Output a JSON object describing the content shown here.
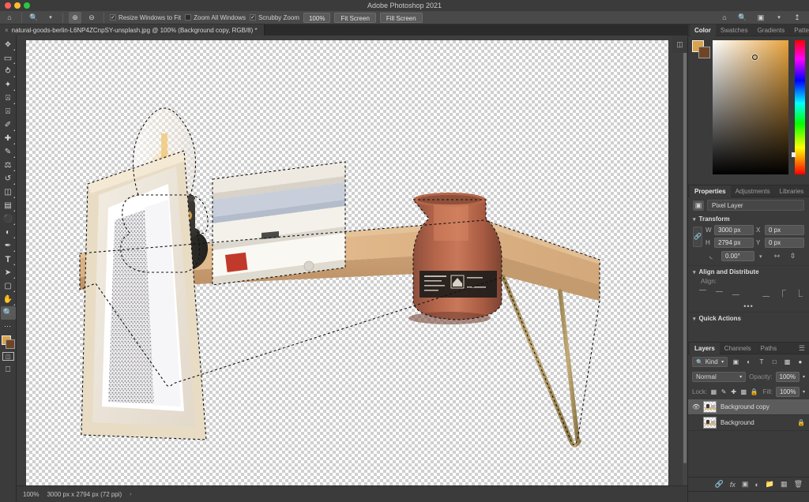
{
  "window": {
    "title": "Adobe Photoshop 2021"
  },
  "options_bar": {
    "home_icon": "home-icon",
    "tool_icon": "zoom-tool-icon",
    "preset_caret": "chevron-down-icon",
    "zoom_in_icon": "zoom-in-icon",
    "zoom_out_icon": "zoom-out-icon",
    "checkboxes": [
      {
        "label": "Resize Windows to Fit",
        "checked": true
      },
      {
        "label": "Zoom All Windows",
        "checked": false
      },
      {
        "label": "Scrubby Zoom",
        "checked": true
      }
    ],
    "zoom_value": "100%",
    "buttons": [
      "Fit Screen",
      "Fill Screen"
    ],
    "right_icons": [
      "discover-icon",
      "search-icon",
      "arrange-documents-icon",
      "chevron-down-icon",
      "share-icon"
    ]
  },
  "document_tab": {
    "title": "natural-goods-berlin-L6NP4ZCnpSY-unsplash.jpg @ 100% (Background copy, RGB/8) *",
    "close_glyph": "×"
  },
  "toolbar": {
    "tools": [
      {
        "name": "move-tool",
        "glyph": "✥",
        "active": false,
        "group": true
      },
      {
        "name": "rectangular-marquee-tool",
        "glyph": "▭",
        "active": false,
        "group": true
      },
      {
        "name": "lasso-tool",
        "glyph": "ᒐ",
        "active": false,
        "group": true
      },
      {
        "name": "object-selection-tool",
        "glyph": "✧",
        "active": false,
        "group": true
      },
      {
        "name": "crop-tool",
        "glyph": "⌗",
        "active": false,
        "group": true
      },
      {
        "name": "frame-tool",
        "glyph": "⧉",
        "active": false,
        "group": false
      },
      {
        "name": "eyedropper-tool",
        "glyph": "✐",
        "active": false,
        "group": true
      },
      {
        "name": "spot-healing-brush-tool",
        "glyph": "✚",
        "active": false,
        "group": true
      },
      {
        "name": "brush-tool",
        "glyph": "🖌",
        "active": false,
        "group": true
      },
      {
        "name": "clone-stamp-tool",
        "glyph": "⌁",
        "active": false,
        "group": true
      },
      {
        "name": "history-brush-tool",
        "glyph": "↺",
        "active": false,
        "group": true
      },
      {
        "name": "eraser-tool",
        "glyph": "◩",
        "active": false,
        "group": true
      },
      {
        "name": "gradient-tool",
        "glyph": "▤",
        "active": false,
        "group": true
      },
      {
        "name": "blur-tool",
        "glyph": "💧",
        "active": false,
        "group": true
      },
      {
        "name": "dodge-tool",
        "glyph": "◐",
        "active": false,
        "group": true
      },
      {
        "name": "pen-tool",
        "glyph": "✒",
        "active": false,
        "group": true
      },
      {
        "name": "type-tool",
        "glyph": "T",
        "active": false,
        "group": true
      },
      {
        "name": "path-selection-tool",
        "glyph": "➤",
        "active": false,
        "group": true
      },
      {
        "name": "rectangle-tool",
        "glyph": "▢",
        "active": false,
        "group": true
      },
      {
        "name": "hand-tool",
        "glyph": "✋",
        "active": false,
        "group": true
      },
      {
        "name": "zoom-tool",
        "glyph": "🔍",
        "active": true,
        "group": false
      },
      {
        "name": "edit-toolbar-tool",
        "glyph": "•••",
        "active": false,
        "group": false
      }
    ],
    "foreground_color": "#d9a34a",
    "background_color": "#6e4627",
    "quick_mask_icon": "quick-mask-icon",
    "screen_mode_icon": "screen-mode-icon"
  },
  "canvas": {
    "zoom": "100%",
    "selection_active": true
  },
  "status_bar": {
    "zoom": "100%",
    "doc_size": "3000 px x 2794 px (72 ppi)",
    "arrow": "›"
  },
  "color_panel": {
    "tabs": [
      "Color",
      "Swatches",
      "Gradients",
      "Patterns"
    ],
    "active_tab": "Color",
    "menu_glyph": "☰",
    "foreground_color": "#d9a34a",
    "background_color": "#6e4627",
    "picker_base_color": "#e8a33d"
  },
  "properties_panel": {
    "tabs": [
      "Properties",
      "Adjustments",
      "Libraries"
    ],
    "active_tab": "Properties",
    "menu_glyph": "☰",
    "layer_type": "Pixel Layer",
    "layer_type_icon": "pixel-layer-icon",
    "sections": {
      "transform": {
        "title": "Transform",
        "width_label": "W",
        "width_value": "3000 px",
        "height_label": "H",
        "height_value": "2794 px",
        "x_label": "X",
        "x_value": "0 px",
        "y_label": "Y",
        "y_value": "0 px",
        "angle_value": "0.00°",
        "link_icon": "link-icon",
        "flip_h_icon": "flip-horizontal-icon",
        "flip_v_icon": "flip-vertical-icon"
      },
      "align": {
        "title": "Align and Distribute",
        "align_label": "Align:",
        "more_glyph": "•••",
        "align_icons": [
          "align-left-icon",
          "align-center-horizontal-icon",
          "align-right-icon",
          "align-top-icon",
          "align-middle-vertical-icon",
          "align-bottom-icon"
        ]
      },
      "quick_actions": {
        "title": "Quick Actions"
      }
    }
  },
  "layers_panel": {
    "tabs": [
      "Layers",
      "Channels",
      "Paths"
    ],
    "active_tab": "Layers",
    "menu_glyph": "☰",
    "filter_label": "Kind",
    "filter_icon": "search-icon",
    "filter_caret": "chevron-down-icon",
    "filter_type_icons": [
      "pixel-filter-icon",
      "adjustment-filter-icon",
      "type-filter-icon",
      "shape-filter-icon",
      "smart-object-filter-icon",
      "filter-toggle-icon"
    ],
    "blend_mode": "Normal",
    "opacity_label": "Opacity:",
    "opacity_value": "100%",
    "lock_label": "Lock:",
    "lock_icons": [
      "lock-transparency-icon",
      "lock-image-icon",
      "lock-position-icon",
      "lock-artboard-icon",
      "lock-all-icon"
    ],
    "fill_label": "Fill:",
    "fill_value": "100%",
    "layers": [
      {
        "name": "Background copy",
        "visible": true,
        "selected": true,
        "locked": false
      },
      {
        "name": "Background",
        "visible": false,
        "selected": false,
        "locked": true
      }
    ],
    "footer_icons": [
      "link-layers-icon",
      "layer-style-icon",
      "layer-mask-icon",
      "new-adjustment-layer-icon",
      "new-group-icon",
      "new-layer-icon",
      "delete-layer-icon"
    ]
  },
  "collapse_panel_icon": "collapse-panel-icon"
}
